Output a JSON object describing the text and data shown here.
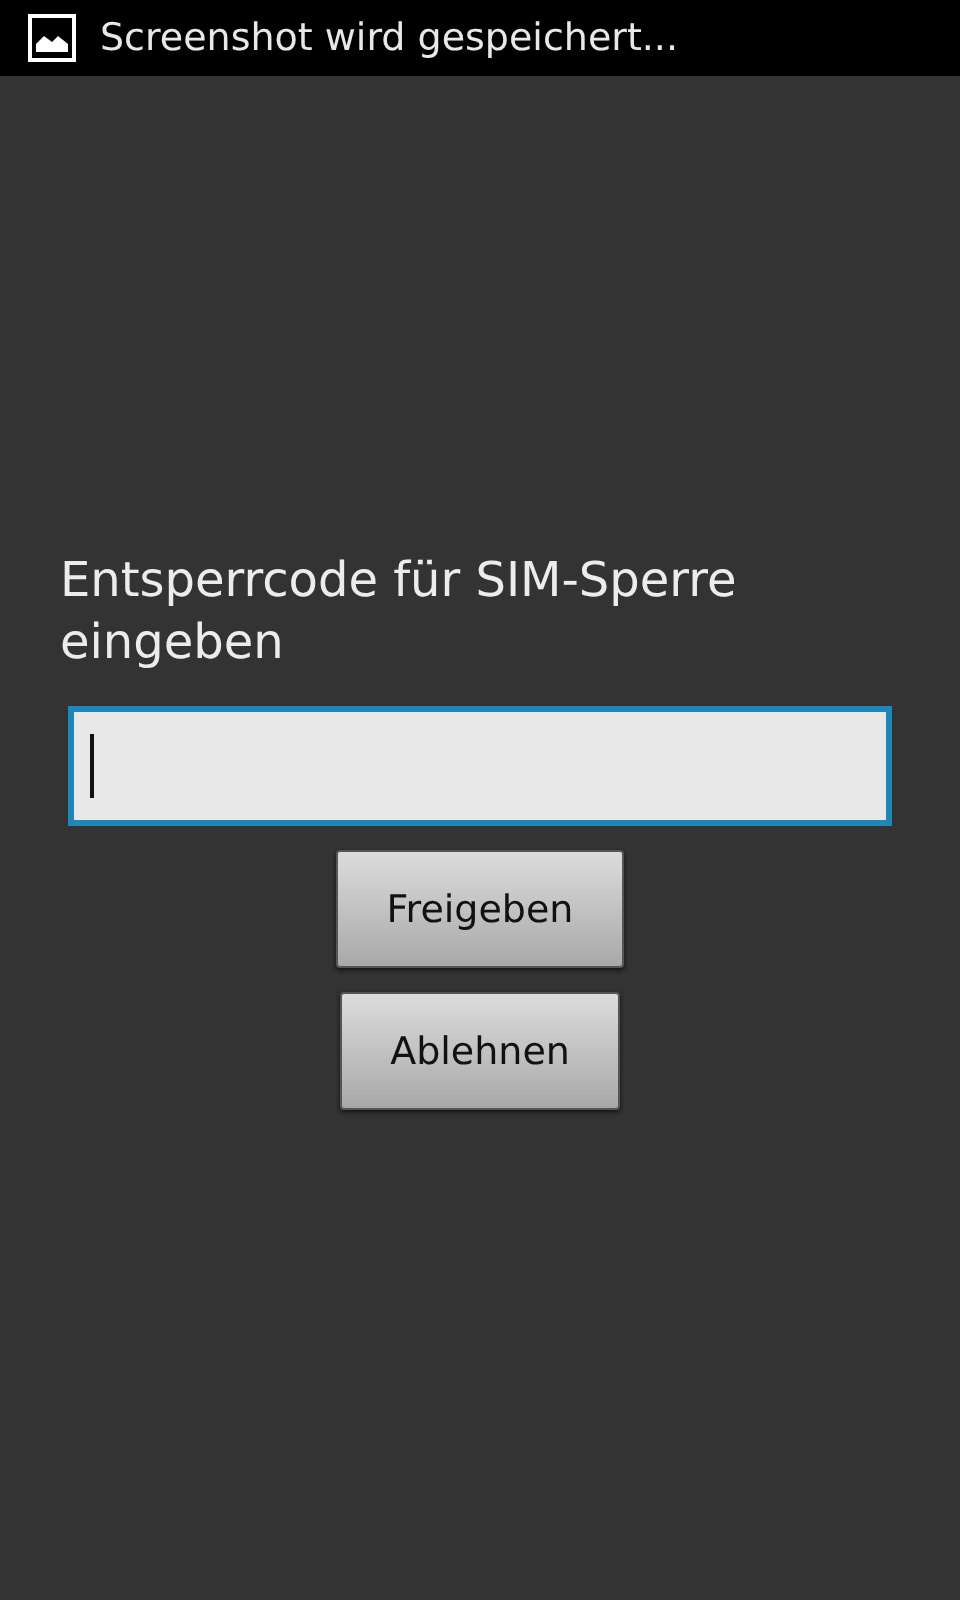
{
  "status_bar": {
    "notification": "Screenshot wird gespeichert..."
  },
  "prompt": "Entsperrcode für SIM-Sperre eingeben",
  "code_field": {
    "focused": true
  },
  "buttons": [
    {
      "label": "Freigeben"
    },
    {
      "label": "Ablehnen"
    }
  ]
}
